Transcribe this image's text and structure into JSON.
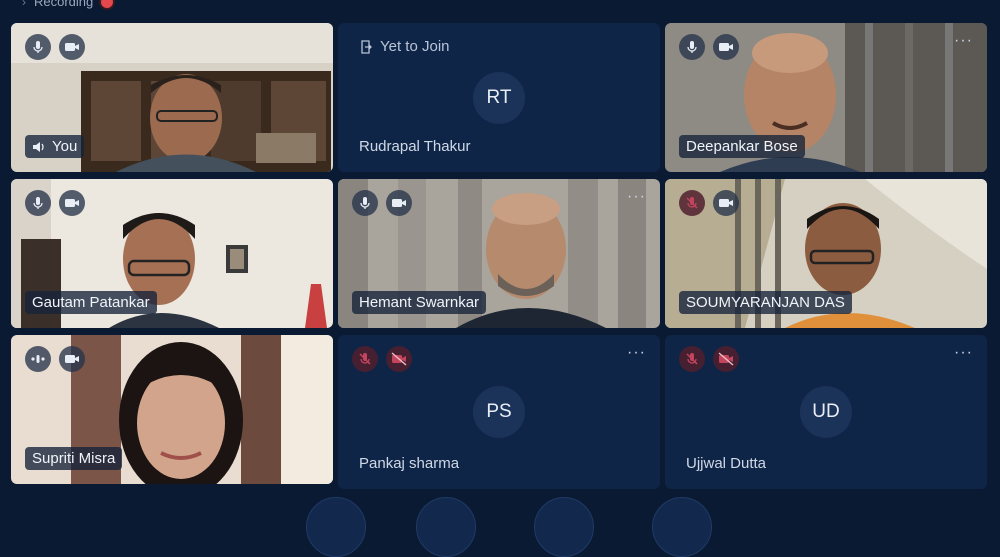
{
  "header": {
    "recording_label": "Recording"
  },
  "tiles": [
    {
      "name": "You"
    },
    {
      "status": "Yet to Join",
      "initials": "RT",
      "name": "Rudrapal Thakur"
    },
    {
      "name": "Deepankar Bose"
    },
    {
      "name": "Gautam Patankar"
    },
    {
      "name": "Hemant Swarnkar"
    },
    {
      "name": "SOUMYARANJAN DAS"
    },
    {
      "name": "Supriti Misra"
    },
    {
      "initials": "PS",
      "name": "Pankaj sharma"
    },
    {
      "initials": "UD",
      "name": "Ujjwal Dutta"
    }
  ],
  "more_glyph": "···",
  "colors": {
    "background": "#0a1a33",
    "tile": "#0e2345",
    "recording": "#e5484d",
    "muted": "#c2455d"
  },
  "icons": [
    "microphone-icon",
    "camera-icon",
    "mic-off-icon",
    "camera-off-icon",
    "speaker-icon",
    "audio-level-icon",
    "exit-door-icon",
    "more-options-icon",
    "recording-dot-icon"
  ]
}
